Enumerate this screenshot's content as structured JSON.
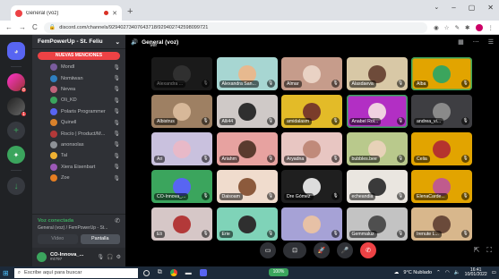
{
  "browser": {
    "tab_title": "General (voz)",
    "url": "discord.com/channels/929402734076437​18/929402742598099721",
    "new_tab": "+",
    "back": "←",
    "forward": "→",
    "reload": "C"
  },
  "servers": {
    "home_icon": "discord-logo-icon",
    "items": [
      {
        "badge": "8"
      },
      {
        "badge": "1"
      }
    ],
    "add_label": "+",
    "explore_label": "✦",
    "download_label": "↓"
  },
  "guild": {
    "name": "FemPowerUp - St. Feliu",
    "chevron": "⌄",
    "banner": "NUEVAS MENCIONES",
    "members": [
      {
        "name": "Mondl",
        "color": "#7a5c9e"
      },
      {
        "name": "Nomiiwan",
        "color": "#2f7fbf"
      },
      {
        "name": "Nevea",
        "color": "#c2637a"
      },
      {
        "name": "Oli_KD",
        "color": "#3ba55d"
      },
      {
        "name": "Polaris Programmer",
        "color": "#5865f2"
      },
      {
        "name": "Quinell",
        "color": "#d9822b"
      },
      {
        "name": "Rocío | Product/M...",
        "color": "#b33939"
      },
      {
        "name": "anonsolas",
        "color": "#8e9297"
      },
      {
        "name": "Tal",
        "color": "#f0b232"
      },
      {
        "name": "Xiera Eisenbart",
        "color": "#9b59b6"
      },
      {
        "name": "Zoe",
        "color": "#e67e22"
      }
    ]
  },
  "voice": {
    "status": "Voz conectada",
    "channel": "General (voz) / FemPowerUp - St...",
    "video_btn": "Vídeo",
    "screen_btn": "Pantalla"
  },
  "user": {
    "name": "CO-Innova_...",
    "tag": "#4797"
  },
  "main": {
    "channel_title": "General (voz)",
    "speaker_icon": "speaker-icon",
    "ver_label": "Ver",
    "tiles": [
      {
        "name": "Alexandra ...",
        "bg": "#3a3a3a",
        "face": "#6b6b6b",
        "focused": true
      },
      {
        "name": "Alexandra San...",
        "bg": "#a7d6d2",
        "face": "#e7b98f"
      },
      {
        "name": "Almar",
        "bg": "#c69c8b",
        "face": "#e9d2c4"
      },
      {
        "name": "Alasdaeva",
        "bg": "#d8c8a6",
        "face": "#6e4b3a"
      },
      {
        "name": "Alba",
        "bg": "#e2a400",
        "face": "#3ba55d",
        "speaking": true
      },
      {
        "name": "Albistrus",
        "bg": "#9e8063",
        "face": "#d7b899"
      },
      {
        "name": "Alli44",
        "bg": "#cfc9c7",
        "face": "#2f2f2f"
      },
      {
        "name": "amidalasm",
        "bg": "#e3bb28",
        "face": "#7a3c2a"
      },
      {
        "name": "Anabel Roi...",
        "bg": "#b22fc4",
        "face": "#f0d2e0",
        "speaking": true
      },
      {
        "name": "andrea_vi...",
        "bg": "#3e3e42",
        "face": "#8a8a8a"
      },
      {
        "name": "Ari",
        "bg": "#c9c1de",
        "face": "#e8b9c8"
      },
      {
        "name": "Ariahm",
        "bg": "#e7a2a0",
        "face": "#5a3b2f"
      },
      {
        "name": "Aryadna",
        "bg": "#e8c6c2",
        "face": "#c08a7a"
      },
      {
        "name": "bubbles.bee",
        "bg": "#b9c98c",
        "face": "#e7d2b8"
      },
      {
        "name": "Celia",
        "bg": "#e2a400",
        "face": "#b5332e"
      },
      {
        "name": "CO-Innova_...",
        "bg": "#3ba55d",
        "face": "#5865f2"
      },
      {
        "name": "Daisoam",
        "bg": "#f0dccd",
        "face": "#8c5a3c"
      },
      {
        "name": "Dre Gómez",
        "bg": "#1f1f1f",
        "face": "#dddddd"
      },
      {
        "name": "echeandia",
        "bg": "#eae6e0",
        "face": "#3a3a3a"
      },
      {
        "name": "ElenaCarde...",
        "bg": "#e2a400",
        "face": "#c05b8d"
      },
      {
        "name": "Eli",
        "bg": "#d6c7c7",
        "face": "#b33939"
      },
      {
        "name": "Erie",
        "bg": "#7fd3b8",
        "face": "#2f2f2f"
      },
      {
        "name": "",
        "bg": "#a6a2d6",
        "face": "#e7c1a6"
      },
      {
        "name": "Gemmaluz",
        "bg": "#c3c3c3",
        "face": "#4f4f4f"
      },
      {
        "name": "Irenute L...",
        "bg": "#d8b78c",
        "face": "#6a4a3a"
      }
    ]
  },
  "callbar": {
    "video_icon": "▭",
    "share_icon": "⊡",
    "activity_icon": "🚀",
    "mic_icon": "🎤",
    "hangup_icon": "✆"
  },
  "taskbar": {
    "search_placeholder": "Escribe aquí para buscar",
    "share_pill": "100%",
    "weather": "9°C Nublado",
    "time": "16:41",
    "date": "10/01/2022"
  }
}
